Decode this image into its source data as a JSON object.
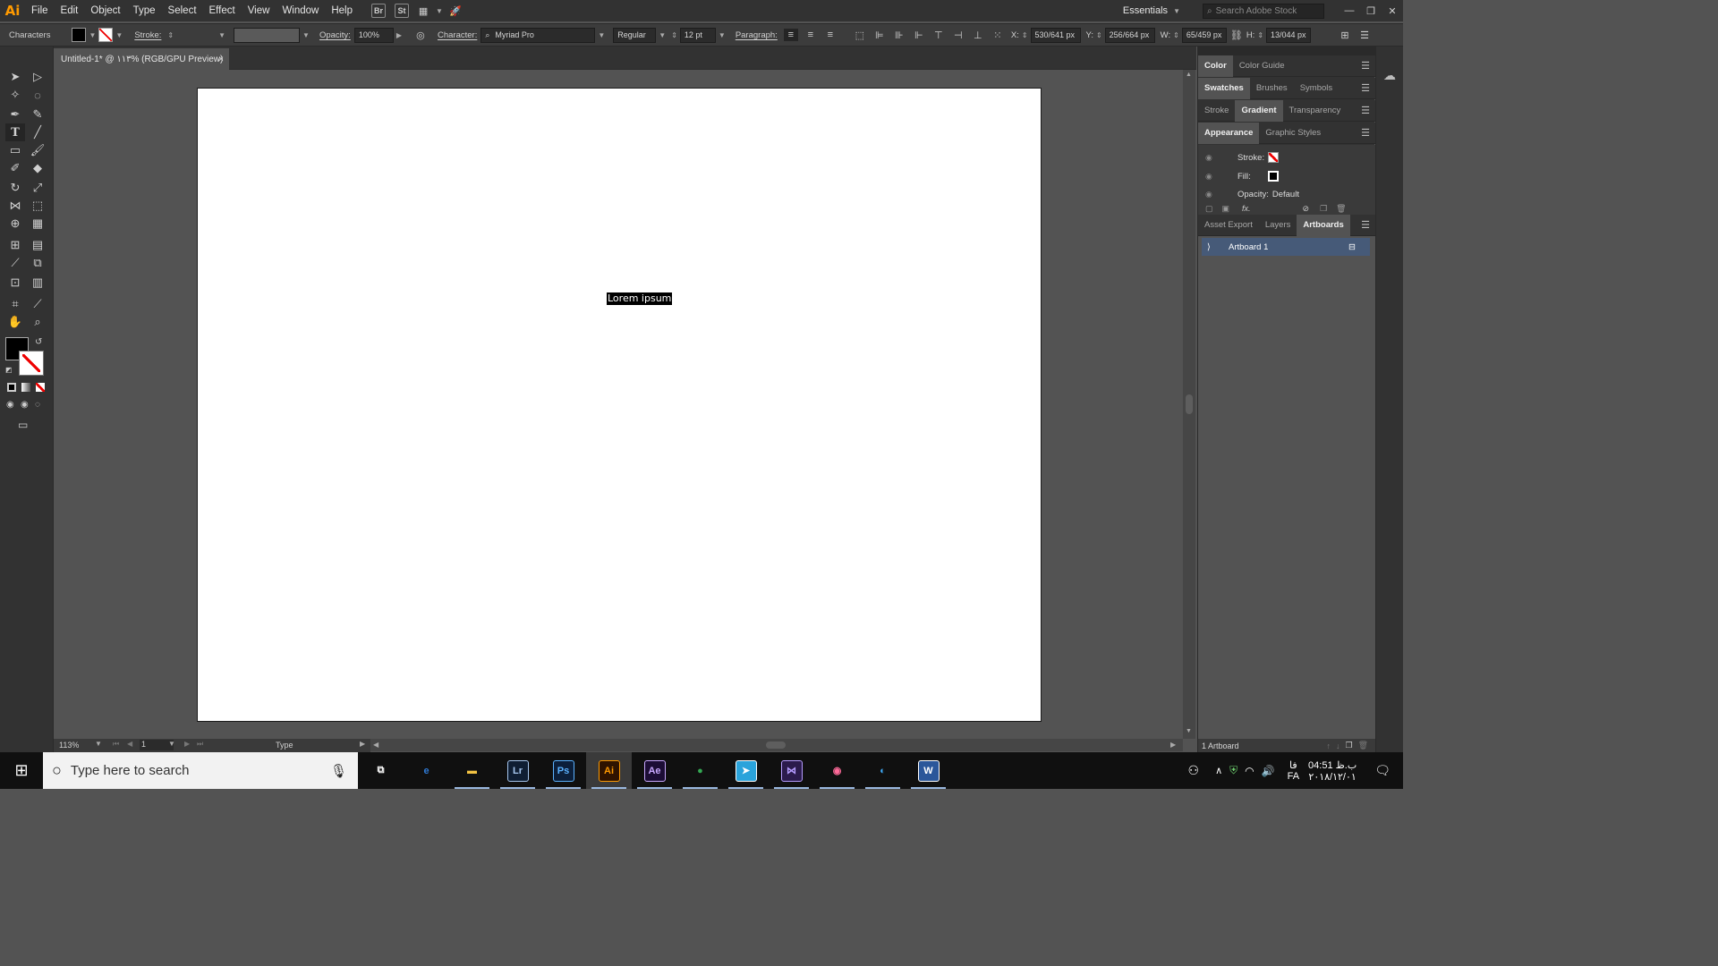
{
  "menubar": {
    "logo": "Ai",
    "items": [
      "File",
      "Edit",
      "Object",
      "Type",
      "Select",
      "Effect",
      "View",
      "Window",
      "Help"
    ],
    "bridge_btn": "Br",
    "stock_btn": "St",
    "workspace": "Essentials",
    "search_placeholder": "Search Adobe Stock"
  },
  "controlbar": {
    "panel_name": "Characters",
    "stroke_label": "Stroke:",
    "opacity_label": "Opacity:",
    "opacity_value": "100%",
    "character_label": "Character:",
    "font_family": "Myriad Pro",
    "font_style": "Regular",
    "font_size": "12 pt",
    "paragraph_label": "Paragraph:",
    "x_label": "X:",
    "x_value": "530/641 px",
    "y_label": "Y:",
    "y_value": "256/664 px",
    "w_label": "W:",
    "w_value": "65/459 px",
    "h_label": "H:",
    "h_value": "13/044 px"
  },
  "document": {
    "tab_title": "Untitled-1* @ ۱۱۳% (RGB/GPU Preview)",
    "close_glyph": "×",
    "canvas_text": "Lorem ipsum"
  },
  "statusbar": {
    "zoom": "113%",
    "artboard_num": "1",
    "tool": "Type"
  },
  "panels": {
    "row1_tabs": [
      "Color",
      "Color Guide"
    ],
    "row2_tabs": [
      "Swatches",
      "Brushes",
      "Symbols"
    ],
    "row3_tabs": [
      "Stroke",
      "Gradient",
      "Transparency"
    ],
    "row4_tabs": [
      "Appearance",
      "Graphic Styles"
    ],
    "appearance": {
      "stroke_label": "Stroke:",
      "fill_label": "Fill:",
      "opacity_label": "Opacity:",
      "opacity_value": "Default",
      "fx": "fx."
    },
    "row5_tabs": [
      "Asset Export",
      "Layers",
      "Artboards"
    ],
    "artboard_item": "Artboard 1",
    "artboard_count": "1 Artboard"
  },
  "taskbar": {
    "search_placeholder": "Type here to search",
    "apps": [
      {
        "name": "Edge",
        "glyph": "e",
        "color": "#2f7bd6",
        "bg": "transparent"
      },
      {
        "name": "Explorer",
        "glyph": "▬",
        "color": "#f3c343",
        "bg": "transparent"
      },
      {
        "name": "Lightroom",
        "glyph": "Lr",
        "color": "#a6c6ee",
        "bg": "#0f1e33"
      },
      {
        "name": "Photoshop",
        "glyph": "Ps",
        "color": "#5bb2ff",
        "bg": "#0c1f3a"
      },
      {
        "name": "Illustrator",
        "glyph": "Ai",
        "color": "#ff9a00",
        "bg": "#2f1300"
      },
      {
        "name": "After Effects",
        "glyph": "Ae",
        "color": "#c9a7ff",
        "bg": "#1c0d35"
      },
      {
        "name": "Chrome",
        "glyph": "●",
        "color": "#34a853",
        "bg": "transparent"
      },
      {
        "name": "Telegram",
        "glyph": "➤",
        "color": "#ffffff",
        "bg": "#2aa3db"
      },
      {
        "name": "Visual Studio",
        "glyph": "⋈",
        "color": "#b59cff",
        "bg": "#2b1b4c"
      },
      {
        "name": "Maps",
        "glyph": "◉",
        "color": "#ff6a9a",
        "bg": "transparent"
      },
      {
        "name": "Shield",
        "glyph": "◐",
        "color": "#3fa9f5",
        "bg": "transparent"
      },
      {
        "name": "Word",
        "glyph": "W",
        "color": "#ffffff",
        "bg": "#2b579a"
      }
    ],
    "lang": "FA",
    "time": "04:51 ب.ظ",
    "date": "۲۰۱۸/۱۲/۰۱"
  }
}
